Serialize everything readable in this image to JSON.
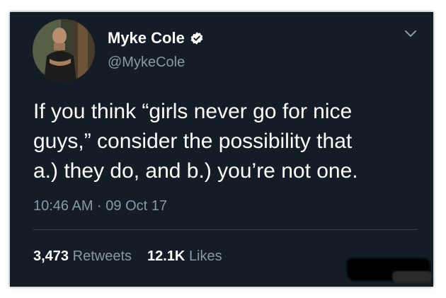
{
  "author": {
    "display_name": "Myke Cole",
    "handle": "@MykeCole",
    "verified": true
  },
  "tweet": {
    "lines": [
      "If you think “girls never go for nice",
      "guys,” consider the possibility that",
      "a.) they do, and b.) you’re not one."
    ],
    "timestamp": "10:46 AM · 09 Oct 17"
  },
  "stats": {
    "retweets_count": "3,473",
    "retweets_label": "Retweets",
    "likes_count": "12.1K",
    "likes_label": "Likes"
  },
  "icons": {
    "verified": "verified-badge-icon",
    "menu": "chevron-down-icon"
  },
  "colors": {
    "background": "#141d26",
    "primary_text": "#ffffff",
    "secondary_text": "#8899a6",
    "divider": "#38444d"
  }
}
